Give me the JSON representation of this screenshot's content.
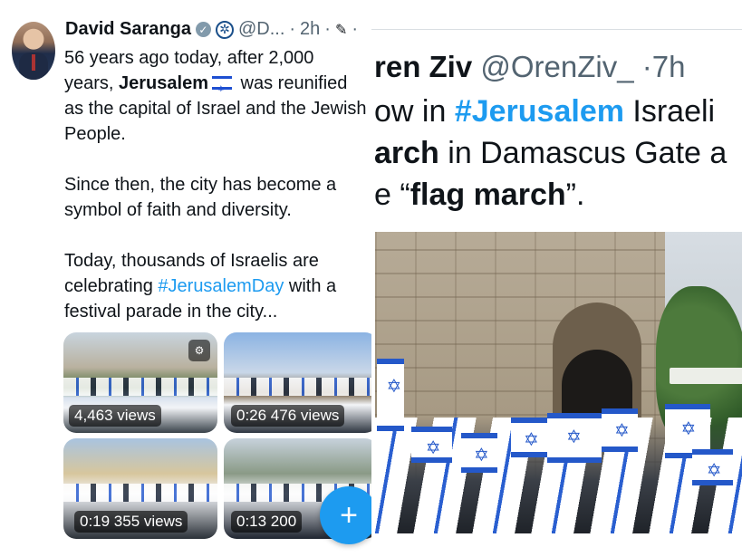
{
  "tweet": {
    "author_name": "David Saranga",
    "handle": "@D...",
    "separator": "·",
    "time": "2h",
    "more_dots": "·",
    "icons": [
      "verified-badge-icon",
      "organization-badge-icon",
      "edit-pen-icon"
    ],
    "paragraph1": {
      "lead": "56 years ago today, after 2,000 years, ",
      "city": "Jerusalem",
      "tail": " was reunified as the capital of Israel and the Jewish People."
    },
    "paragraph2": "Since then, the city has become a symbol of faith and diversity.",
    "paragraph3": {
      "lead": "Today, thousands of Israelis are celebrating ",
      "hashtag": "#JerusalemDay",
      "tail": " with a festival parade in the city..."
    },
    "media": [
      {
        "badge": "4,463 views"
      },
      {
        "badge": "0:26  476 views"
      },
      {
        "badge": "0:19  355 views"
      },
      {
        "badge": "0:13  200"
      }
    ],
    "compose_label": "+"
  },
  "quote": {
    "author_name_partial": "ren Ziv",
    "handle": "@OrenZiv_",
    "separator": "·",
    "time": "7h",
    "line1_pre": "ow in ",
    "line1_hashtag": "#Jerusalem",
    "line1_post": " Israeli",
    "line2_bold": "arch",
    "line2_rest": " in Damascus Gate a",
    "line3_pre": "e “",
    "line3_bold": "flag march",
    "line3_post": "”."
  },
  "colors": {
    "link": "#1d9bf0",
    "text": "#0f1419",
    "secondary": "#536471",
    "flag_blue": "#2458c9"
  }
}
